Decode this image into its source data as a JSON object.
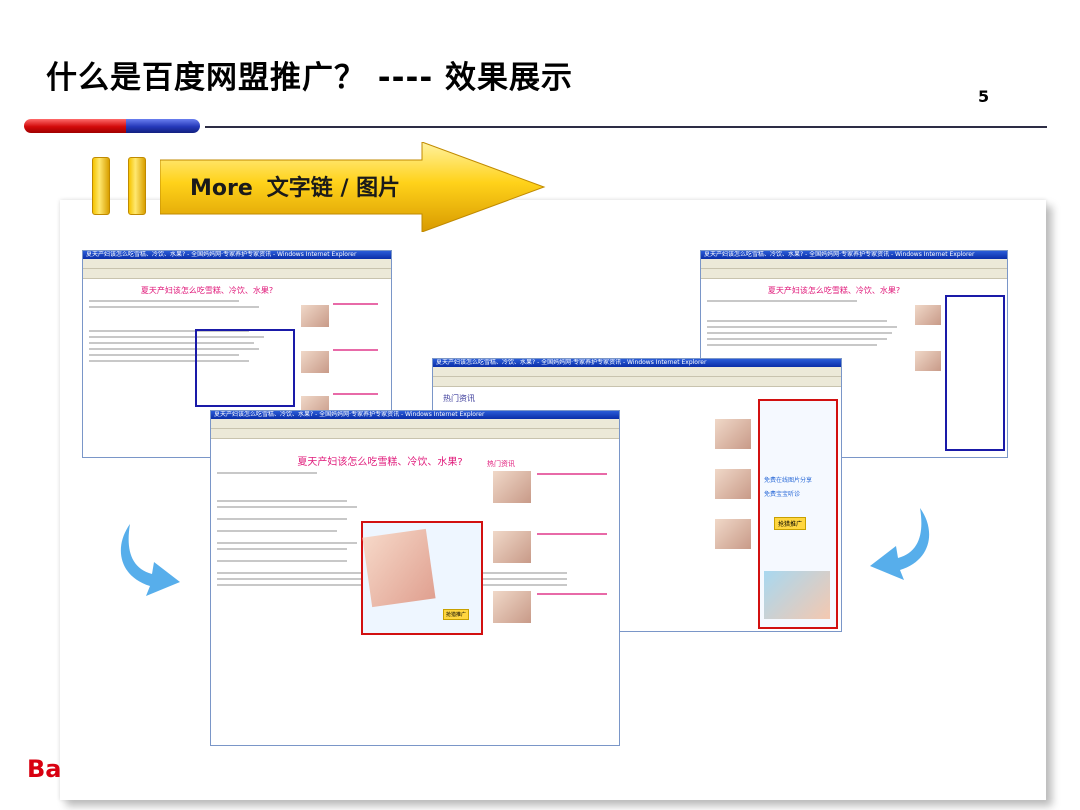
{
  "slide": {
    "title": "什么是百度网盟推广？ ---- 效果展示",
    "page_number": "5",
    "logo_partial": "Ba"
  },
  "arrow_banner": {
    "more_label": "More",
    "caption": "文字链 / 图片"
  },
  "screens": {
    "back_window_title": "夏天产妇该怎么吃雪糕、冷饮、水果? - 全国妈妈网·专家养护专家资讯 - Windows Internet Explorer",
    "headline": "夏天产妇该怎么吃雪糕、冷饮、水果?",
    "front_headline": "夏天产妇该怎么吃雪糕、冷饮、水果?",
    "hot_reading": "热门资讯",
    "ad_link_1": "免费在线图片分享",
    "ad_link_2": "免费宝宝听诊",
    "ad_button": "抢猎推广"
  },
  "colors": {
    "title_text": "#000000",
    "accent_red": "#d20a0a",
    "accent_blue": "#2438b8",
    "arrow_gold": "#f5c400",
    "headline_pink": "#e0197a",
    "highlight_blue": "#1a1aa8",
    "highlight_red": "#d21010"
  }
}
